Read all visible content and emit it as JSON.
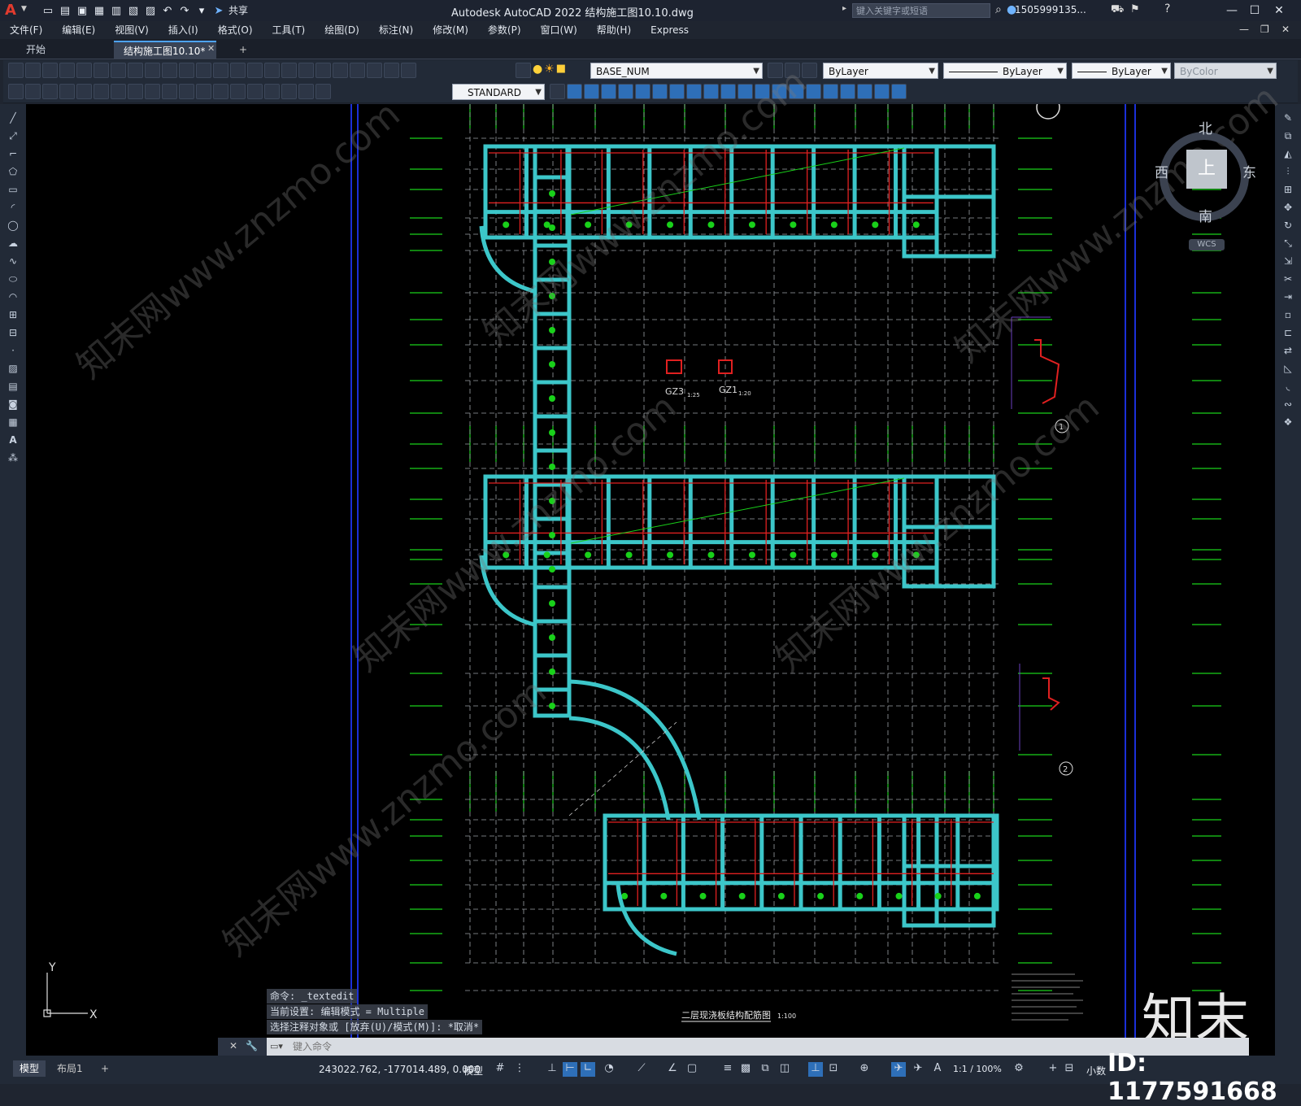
{
  "window": {
    "app_title": "Autodesk AutoCAD 2022    结构施工图10.10.dwg",
    "search_placeholder": "键入关键字或短语",
    "user": "1505999135...",
    "share_label": "共享"
  },
  "menu": [
    "文件(F)",
    "编辑(E)",
    "视图(V)",
    "插入(I)",
    "格式(O)",
    "工具(T)",
    "绘图(D)",
    "标注(N)",
    "修改(M)",
    "参数(P)",
    "窗口(W)",
    "帮助(H)",
    "Express"
  ],
  "tabs": {
    "start": "开始",
    "active": "结构施工图10.10*",
    "add": "+"
  },
  "toolbar": {
    "layer": "BASE_NUM",
    "color": "ByLayer",
    "linetype": "ByLayer",
    "lineweight": "ByLayer",
    "plotstyle": "ByColor",
    "text_style": "STANDARD"
  },
  "viewcube": {
    "north": "北",
    "south": "南",
    "east": "东",
    "west": "西",
    "top": "上",
    "wcs": "WCS"
  },
  "drawing": {
    "title": "二层现浇板结构配筋图",
    "scale": "1:100",
    "detail_gz3": "GZ3",
    "detail_gz3_scale": "1:25",
    "detail_gz1": "GZ1",
    "detail_gz1_scale": "1:20",
    "section_1": "1",
    "section_2": "2",
    "axis_y": "Y",
    "axis_x": "X"
  },
  "command": {
    "line1": "命令: _textedit",
    "line2": "当前设置: 编辑模式 = Multiple",
    "line3": "选择注释对象或 [放弃(U)/模式(M)]: *取消*",
    "input_placeholder": "键入命令"
  },
  "status": {
    "model_tab": "模型",
    "layout_tab": "布局1",
    "coords": "243022.762, -177014.489, 0.000",
    "model_btn": "模型",
    "scale": "1:1 / 100%",
    "units": "小数"
  },
  "watermark": {
    "brand": "知末",
    "id": "ID: 1177591668",
    "site": "知末网www.znzmo.com"
  },
  "colors": {
    "canvas": "#000000",
    "beam": "#3cc6c9",
    "rebar": "#e02020",
    "grid": "#19d11a",
    "axis_blue": "#1b2fd8"
  }
}
